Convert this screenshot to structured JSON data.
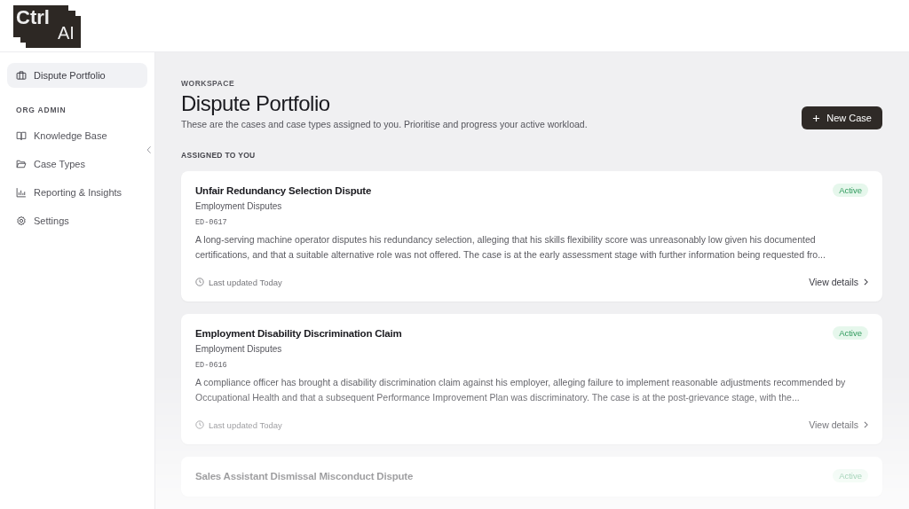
{
  "logo": {
    "line_1": "Ctrl",
    "line_2": "AI"
  },
  "sidebar": {
    "top_items": [
      {
        "label": "Dispute Portfolio",
        "selected": true
      }
    ],
    "section_title": "ORG ADMIN",
    "items": [
      {
        "label": "Knowledge Base",
        "selected": false
      },
      {
        "label": "Case Types",
        "selected": false
      },
      {
        "label": "Reporting & Insights",
        "selected": false
      },
      {
        "label": "Settings",
        "selected": false
      }
    ]
  },
  "page": {
    "eyebrow": "WORKSPACE",
    "title": "Dispute Portfolio",
    "subtitle": "These are the cases and case types assigned to you. Prioritise and progress your active workload.",
    "new_button": "New Case",
    "section_title": "ASSIGNED TO YOU"
  },
  "cases": [
    {
      "title": "Unfair Redundancy Selection Dispute",
      "type": "Employment Disputes",
      "id": "ED-0617",
      "status": "Active",
      "description": "A long-serving machine operator disputes his redundancy selection, alleging that his skills flexibility score was unreasonably low given his documented certifications, and that a suitable alternative role was not offered. The case is at the early assessment stage with further information being requested fro...",
      "updated": "Last updated Today",
      "link": "View details"
    },
    {
      "title": "Employment Disability Discrimination Claim",
      "type": "Employment Disputes",
      "id": "ED-0616",
      "status": "Active",
      "description": "A compliance officer has brought a disability discrimination claim against his employer, alleging failure to implement reasonable adjustments recommended by Occupational Health and that a subsequent Performance Improvement Plan was discriminatory. The case is at the post-grievance stage, with the...",
      "updated": "Last updated Today",
      "link": "View details"
    },
    {
      "title": "Sales Assistant Dismissal Misconduct Dispute",
      "status": "Active"
    }
  ]
}
